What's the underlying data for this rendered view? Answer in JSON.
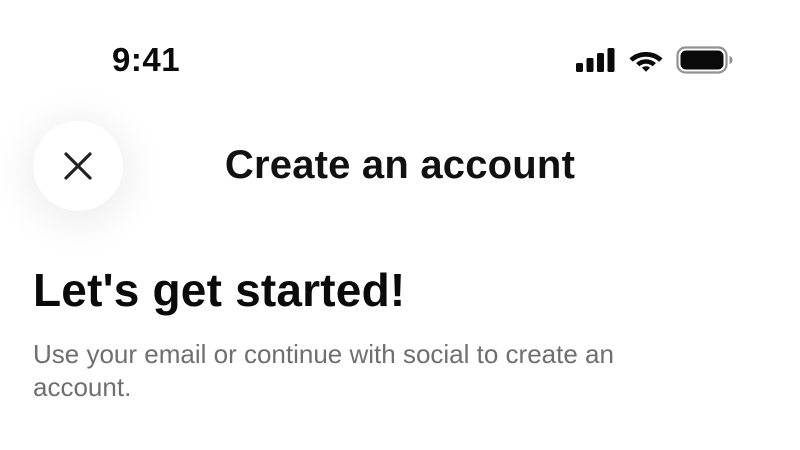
{
  "status_bar": {
    "time": "9:41",
    "icons": [
      "cellular-signal-icon",
      "wifi-icon",
      "battery-icon"
    ]
  },
  "header": {
    "close_icon": "close-icon",
    "title": "Create an account"
  },
  "content": {
    "headline": "Let's get started!",
    "subtext": "Use your email or continue with social to create an account."
  },
  "colors": {
    "text_primary": "#111111",
    "text_secondary": "#6f6f6f",
    "background": "#ffffff"
  }
}
